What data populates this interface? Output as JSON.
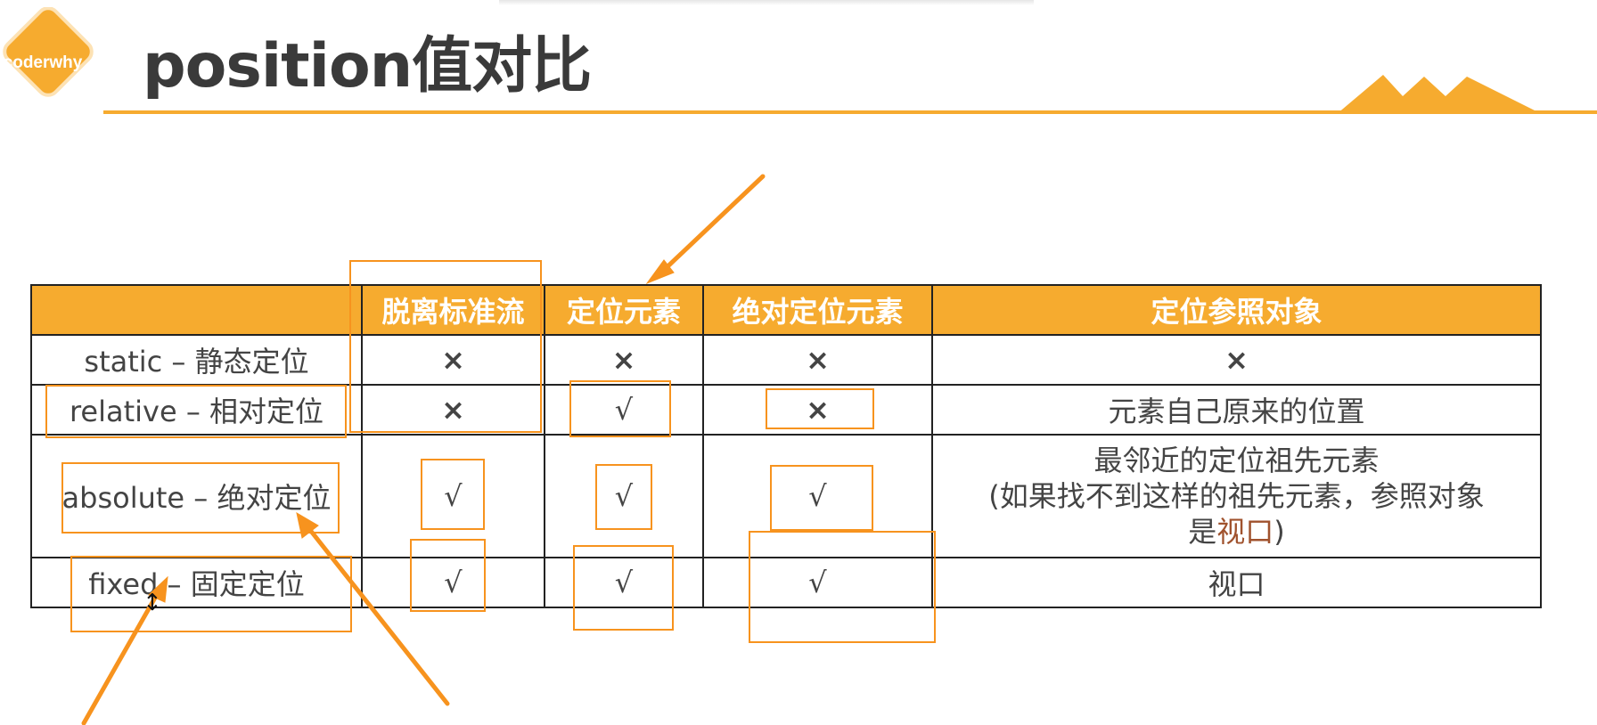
{
  "logo": {
    "text": "coderwhy"
  },
  "title": "position值对比",
  "table": {
    "headers": [
      "",
      "脱离标准流",
      "定位元素",
      "绝对定位元素",
      "定位参照对象"
    ],
    "rows": [
      {
        "label": "static – 静态定位",
        "detached": "×",
        "positioned": "×",
        "absolute_positioned": "×",
        "reference": "×"
      },
      {
        "label": "relative – 相对定位",
        "detached": "×",
        "positioned": "√",
        "absolute_positioned": "×",
        "reference": "元素自己原来的位置"
      },
      {
        "label": "absolute – 绝对定位",
        "detached": "√",
        "positioned": "√",
        "absolute_positioned": "√",
        "reference_lines": [
          "最邻近的定位祖先元素",
          "(如果找不到这样的祖先元素，参照对象",
          "是"
        ],
        "reference_highlight": "视口",
        "reference_tail": ")"
      },
      {
        "label": "fixed – 固定定位",
        "detached": "√",
        "positioned": "√",
        "absolute_positioned": "√",
        "reference": "视口"
      }
    ]
  },
  "colors": {
    "accent": "#f6ab2f",
    "annotation": "#f7931e",
    "cross": "#e02020",
    "check": "#e8871e",
    "text": "#333333"
  },
  "cursor": {
    "icon": "resize-vertical-cursor-icon",
    "glyph": "↕"
  }
}
